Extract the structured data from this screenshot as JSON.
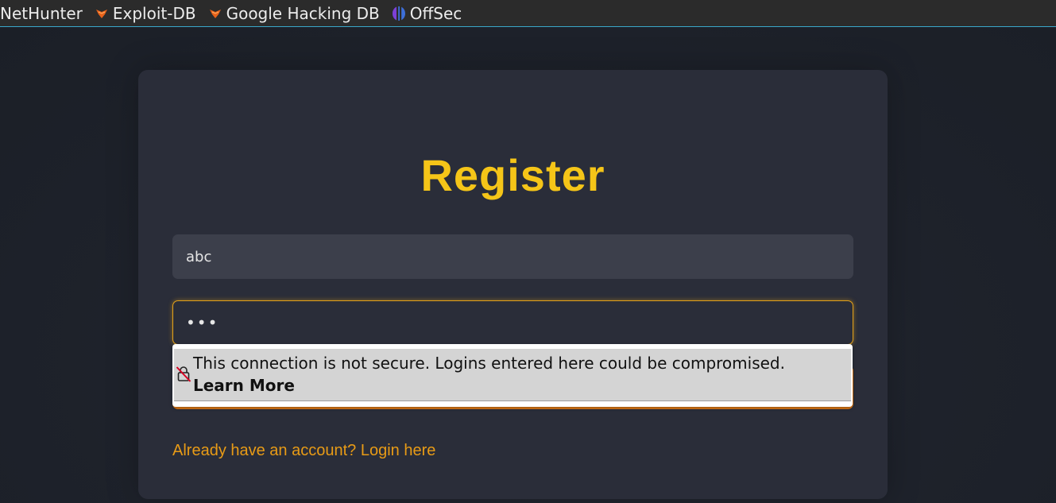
{
  "bookmarks": [
    {
      "label": "NetHunter",
      "icon": "none"
    },
    {
      "label": "Exploit-DB",
      "icon": "exploit-db-icon"
    },
    {
      "label": "Google Hacking DB",
      "icon": "exploit-db-icon"
    },
    {
      "label": "OffSec",
      "icon": "offsec-icon"
    }
  ],
  "form": {
    "title": "Register",
    "username_value": "abc",
    "password_value": "•••",
    "login_link": "Already have an account? Login here"
  },
  "popup": {
    "message": "This connection is not secure. Logins entered here could be compromised.",
    "learn_more": "Learn More"
  },
  "colors": {
    "accent": "#f5c518",
    "button": "#e07a16",
    "link": "#e89b16",
    "card": "#2a2d39",
    "background": "#1e222b"
  }
}
